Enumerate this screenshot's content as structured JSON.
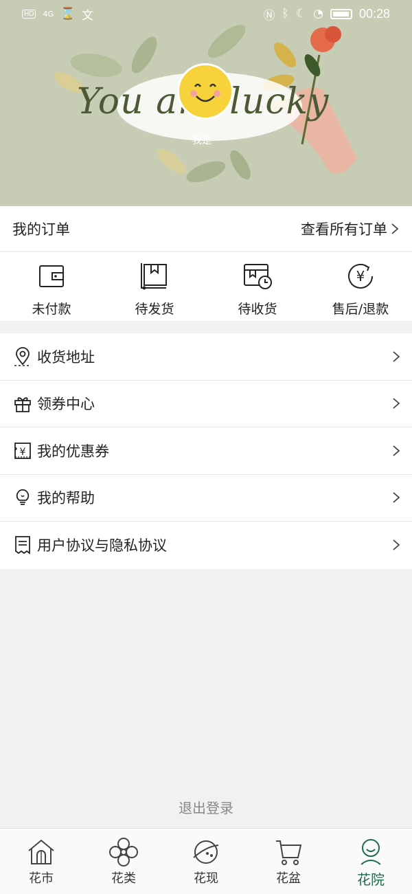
{
  "status_bar": {
    "left_indicators": [
      "HD",
      "4G",
      "⌛",
      "文"
    ],
    "time": "00:28"
  },
  "profile": {
    "banner_text": "You are lucky",
    "nickname": "我是"
  },
  "orders": {
    "title": "我的订单",
    "view_all": "查看所有订单",
    "items": [
      {
        "label": "未付款",
        "icon": "wallet-icon"
      },
      {
        "label": "待发货",
        "icon": "package-icon"
      },
      {
        "label": "待收货",
        "icon": "delivery-icon"
      },
      {
        "label": "售后/退款",
        "icon": "refund-icon"
      }
    ]
  },
  "menu": {
    "items": [
      {
        "label": "收货地址",
        "icon": "location-pin-icon"
      },
      {
        "label": "领券中心",
        "icon": "gift-icon"
      },
      {
        "label": "我的优惠券",
        "icon": "coupon-icon"
      },
      {
        "label": "我的帮助",
        "icon": "lightbulb-icon"
      },
      {
        "label": "用户协议与隐私协议",
        "icon": "document-icon"
      }
    ]
  },
  "logout_label": "退出登录",
  "tabbar": {
    "items": [
      {
        "label": "花市",
        "icon": "house-icon"
      },
      {
        "label": "花类",
        "icon": "flower-icon"
      },
      {
        "label": "花现",
        "icon": "planet-icon"
      },
      {
        "label": "花盆",
        "icon": "cart-icon"
      },
      {
        "label": "花院",
        "icon": "person-icon",
        "active": true
      }
    ]
  },
  "colors": {
    "hero_background": "#c7cdb5",
    "active_tab": "#1e6b4a",
    "page_background": "#f1f1f1"
  }
}
